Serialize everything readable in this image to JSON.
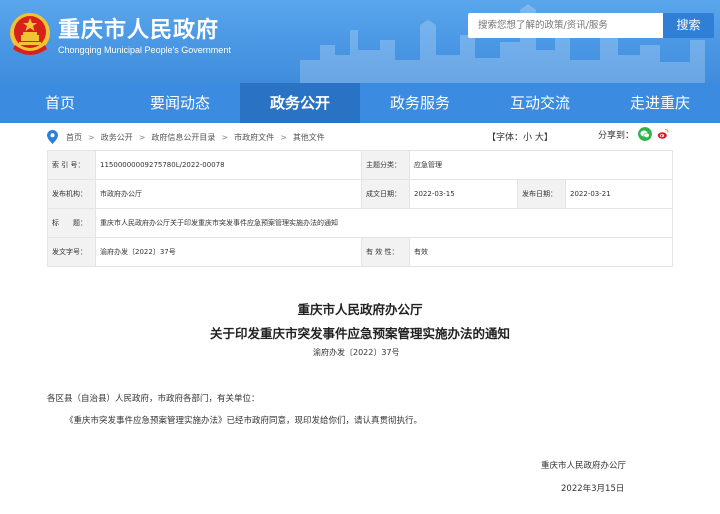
{
  "header": {
    "title": "重庆市人民政府",
    "subtitle": "Chongqing Municipal People's Government",
    "search_placeholder": "搜索您想了解的政策/资讯/服务",
    "search_button": "搜索",
    "colors": {
      "header_blue": "#4c9ae6",
      "nav_blue": "#3b8be0",
      "nav_active": "#2a72c4",
      "emblem_red": "#d7221c",
      "emblem_gold": "#f2c335"
    }
  },
  "nav": {
    "items": [
      "首页",
      "要闻动态",
      "政务公开",
      "政务服务",
      "互动交流",
      "走进重庆"
    ],
    "active_index": 2
  },
  "breadcrumb": {
    "items": [
      "首页",
      "政务公开",
      "政府信息公开目录",
      "市政府文件",
      "其他文件"
    ],
    "separator": ">"
  },
  "tools": {
    "font_size": "【字体：小 大】",
    "share_label": "分享到："
  },
  "info": {
    "index_label": "索 引 号：",
    "index_value": "11500000009275780L/2022-00078",
    "topic_label": "主题分类：",
    "topic_value": "应急管理",
    "issuer_label": "发布机构：",
    "issuer_value": "市政府办公厅",
    "created_label": "成文日期：",
    "created_value": "2022-03-15",
    "published_label": "发布日期：",
    "published_value": "2022-03-21",
    "title_label": "标　　题：",
    "title_value": "重庆市人民政府办公厅关于印发重庆市突发事件应急预案管理实施办法的通知",
    "docno_label": "发文字号：",
    "docno_value": "渝府办发〔2022〕37号",
    "validity_label": "有 效 性：",
    "validity_value": "有效"
  },
  "article": {
    "org": "重庆市人民政府办公厅",
    "title": "关于印发重庆市突发事件应急预案管理实施办法的通知",
    "doc_number": "渝府办发〔2022〕37号",
    "salutation": "各区县（自治县）人民政府，市政府各部门，有关单位：",
    "body": "《重庆市突发事件应急预案管理实施办法》已经市政府同意，现印发给你们，请认真贯彻执行。",
    "signature_org": "重庆市人民政府办公厅",
    "signature_date": "2022年3月15日"
  }
}
